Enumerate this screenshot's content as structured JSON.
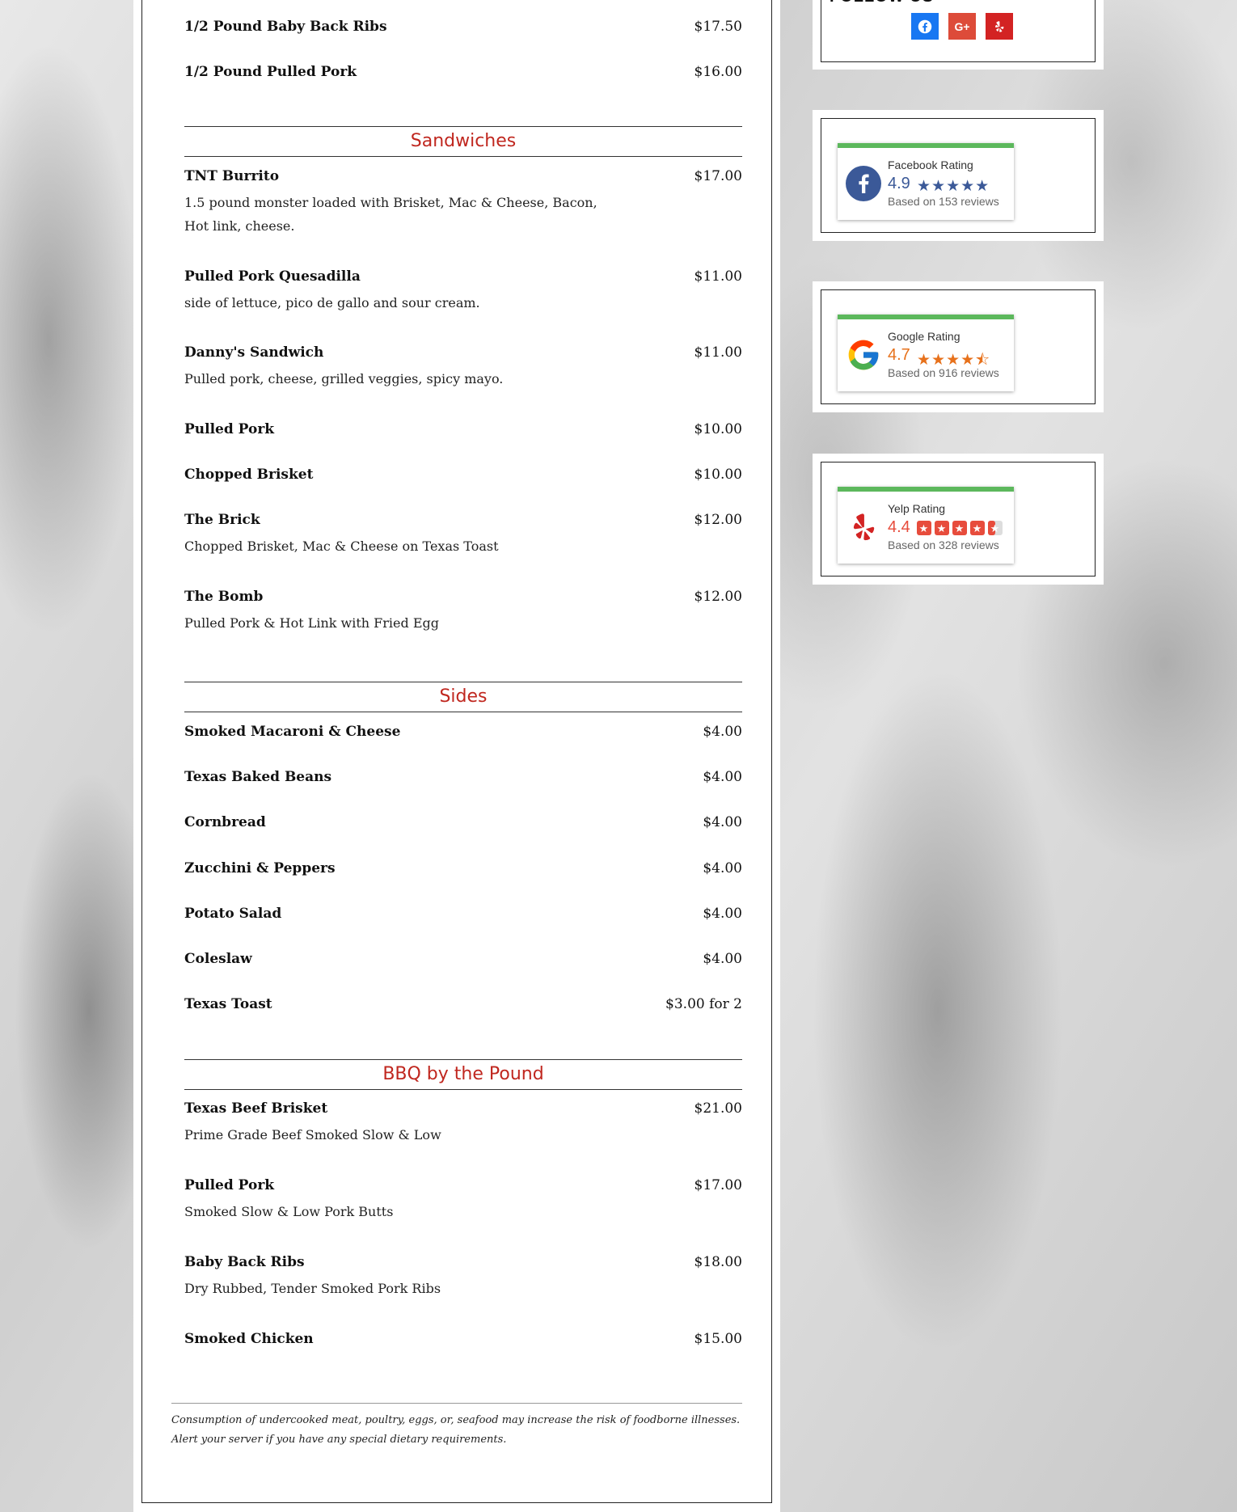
{
  "menu": {
    "top_items": [
      {
        "name": "1/2 Pound Baby Back Ribs",
        "price": "$17.50"
      },
      {
        "name": "1/2 Pound Pulled Pork",
        "price": "$16.00"
      }
    ],
    "sections": [
      {
        "title": "Sandwiches",
        "items": [
          {
            "name": "TNT Burrito",
            "price": "$17.00",
            "desc": "1.5 pound monster loaded with Brisket, Mac & Cheese, Bacon, Hot link, cheese."
          },
          {
            "name": "Pulled Pork Quesadilla",
            "price": "$11.00",
            "desc": "side of lettuce, pico de gallo and sour cream."
          },
          {
            "name": "Danny's Sandwich",
            "price": "$11.00",
            "desc": "Pulled pork, cheese, grilled veggies, spicy mayo."
          },
          {
            "name": "Pulled Pork",
            "price": "$10.00"
          },
          {
            "name": "Chopped Brisket",
            "price": "$10.00"
          },
          {
            "name": "The Brick",
            "price": "$12.00",
            "desc": "Chopped Brisket, Mac & Cheese on Texas Toast"
          },
          {
            "name": "The Bomb",
            "price": "$12.00",
            "desc": "Pulled Pork & Hot Link with Fried Egg"
          }
        ]
      },
      {
        "title": "Sides",
        "items": [
          {
            "name": "Smoked Macaroni & Cheese",
            "price": "$4.00"
          },
          {
            "name": "Texas Baked Beans",
            "price": "$4.00"
          },
          {
            "name": "Cornbread",
            "price": "$4.00"
          },
          {
            "name": "Zucchini & Peppers",
            "price": "$4.00"
          },
          {
            "name": "Potato Salad",
            "price": "$4.00"
          },
          {
            "name": "Coleslaw",
            "price": "$4.00"
          },
          {
            "name": "Texas Toast",
            "price": "$3.00 for 2"
          }
        ]
      },
      {
        "title": "BBQ by the Pound",
        "items": [
          {
            "name": "Texas Beef Brisket",
            "price": "$21.00",
            "desc": "Prime Grade Beef Smoked Slow & Low"
          },
          {
            "name": "Pulled Pork",
            "price": "$17.00",
            "desc": "Smoked Slow & Low Pork Butts"
          },
          {
            "name": "Baby Back Ribs",
            "price": "$18.00",
            "desc": "Dry Rubbed, Tender Smoked Pork Ribs"
          },
          {
            "name": "Smoked Chicken",
            "price": "$15.00"
          }
        ]
      }
    ],
    "disclaimer": "Consumption of undercooked meat, poultry, eggs, or, seafood may increase the risk of foodborne illnesses. Alert your server if you have any special dietary requirements."
  },
  "sidebar": {
    "follow_title": "FOLLOW US",
    "social": [
      {
        "name": "facebook",
        "icon": "facebook-icon",
        "color": "#1877f2"
      },
      {
        "name": "google-plus",
        "icon": "google-plus-icon",
        "color": "#dd4b39"
      },
      {
        "name": "yelp",
        "icon": "yelp-icon",
        "color": "#d32323"
      }
    ],
    "ratings": [
      {
        "title": "Facebook Rating",
        "score": "4.9",
        "reviews": "Based on 153 reviews",
        "icon": "facebook-logo-icon",
        "stars_color": "#3b5998",
        "score_color": "#3b5998",
        "rating": 4.9
      },
      {
        "title": "Google Rating",
        "score": "4.7",
        "reviews": "Based on 916 reviews",
        "icon": "google-logo-icon",
        "stars_color": "#e7711b",
        "score_color": "#e7711b",
        "rating": 4.7
      },
      {
        "title": "Yelp Rating",
        "score": "4.4",
        "reviews": "Based on 328 reviews",
        "icon": "yelp-logo-icon",
        "stars_color": "#e74c3c",
        "score_color": "#e74c3c",
        "rating": 4.4
      }
    ]
  }
}
